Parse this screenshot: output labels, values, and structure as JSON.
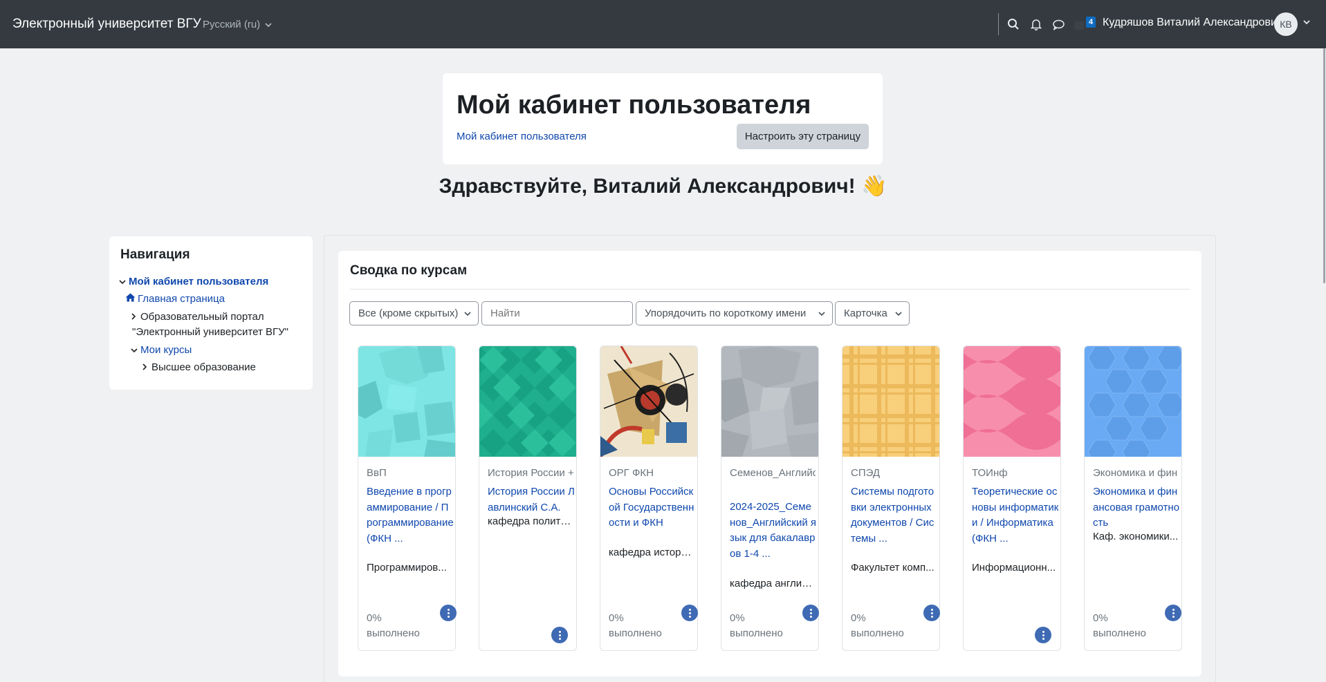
{
  "navbar": {
    "brand": "Электронный университет ВГУ",
    "language": "Русский (ru)",
    "message_badge": "4",
    "user_name": "Кудряшов Виталий Александрович",
    "avatar_initials": "КВ"
  },
  "header": {
    "title": "Мой кабинет пользователя",
    "breadcrumb": "Мой кабинет пользователя",
    "customise_button": "Настроить эту страницу"
  },
  "greeting": "Здравствуйте, Виталий Александрович! 👋",
  "navigation": {
    "title": "Навигация",
    "items": [
      {
        "label": "Мой кабинет пользователя"
      },
      {
        "label": "Главная страница"
      },
      {
        "label": "Образовательный портал"
      },
      {
        "label": "\"Электронный университет ВГУ\""
      },
      {
        "label": "Мои курсы"
      },
      {
        "label": "Высшее образование"
      }
    ]
  },
  "course_overview": {
    "title": "Сводка по курсам",
    "filter_label": "Все (кроме скрытых)",
    "search_placeholder": "Найти",
    "sort_label": "Упорядочить по короткому имени",
    "view_label": "Карточка",
    "progress_word": "выполнено",
    "courses": [
      {
        "category": "ВвП",
        "name": "Введение в программирование / Программирование (ФКН ...",
        "sub": "Программиров...",
        "progress": "0%"
      },
      {
        "category": "История России +",
        "name": "История России Лавлинский С.А.",
        "sub": "кафедра полити...",
        "progress": ""
      },
      {
        "category": "ОРГ ФКН",
        "name": "Основы Российской Государственности и ФКН",
        "sub": "кафедра истори...",
        "progress": "0%"
      },
      {
        "category": "Семенов_Английс",
        "name": "2024-2025_Семенов_Английский язык для бакалавров 1-4 ...",
        "sub": "кафедра англий...",
        "progress": "0%"
      },
      {
        "category": "СПЭД",
        "name": "Системы подготовки электронных документов / Системы ...",
        "sub": "Факультет комп...",
        "progress": "0%"
      },
      {
        "category": "ТОИнф",
        "name": "Теоретические основы информатики / Информатика (ФКН ...",
        "sub": "Информационн...",
        "progress": ""
      },
      {
        "category": "Экономика и фин",
        "name": "Экономика и финансовая грамотность",
        "sub": "Каф. экономики...",
        "progress": "0%"
      }
    ]
  },
  "colors": {
    "navbar": "#343a40",
    "link": "#0f47ad",
    "accent_button": "#3f6ab4",
    "background": "#f0f1f3"
  }
}
